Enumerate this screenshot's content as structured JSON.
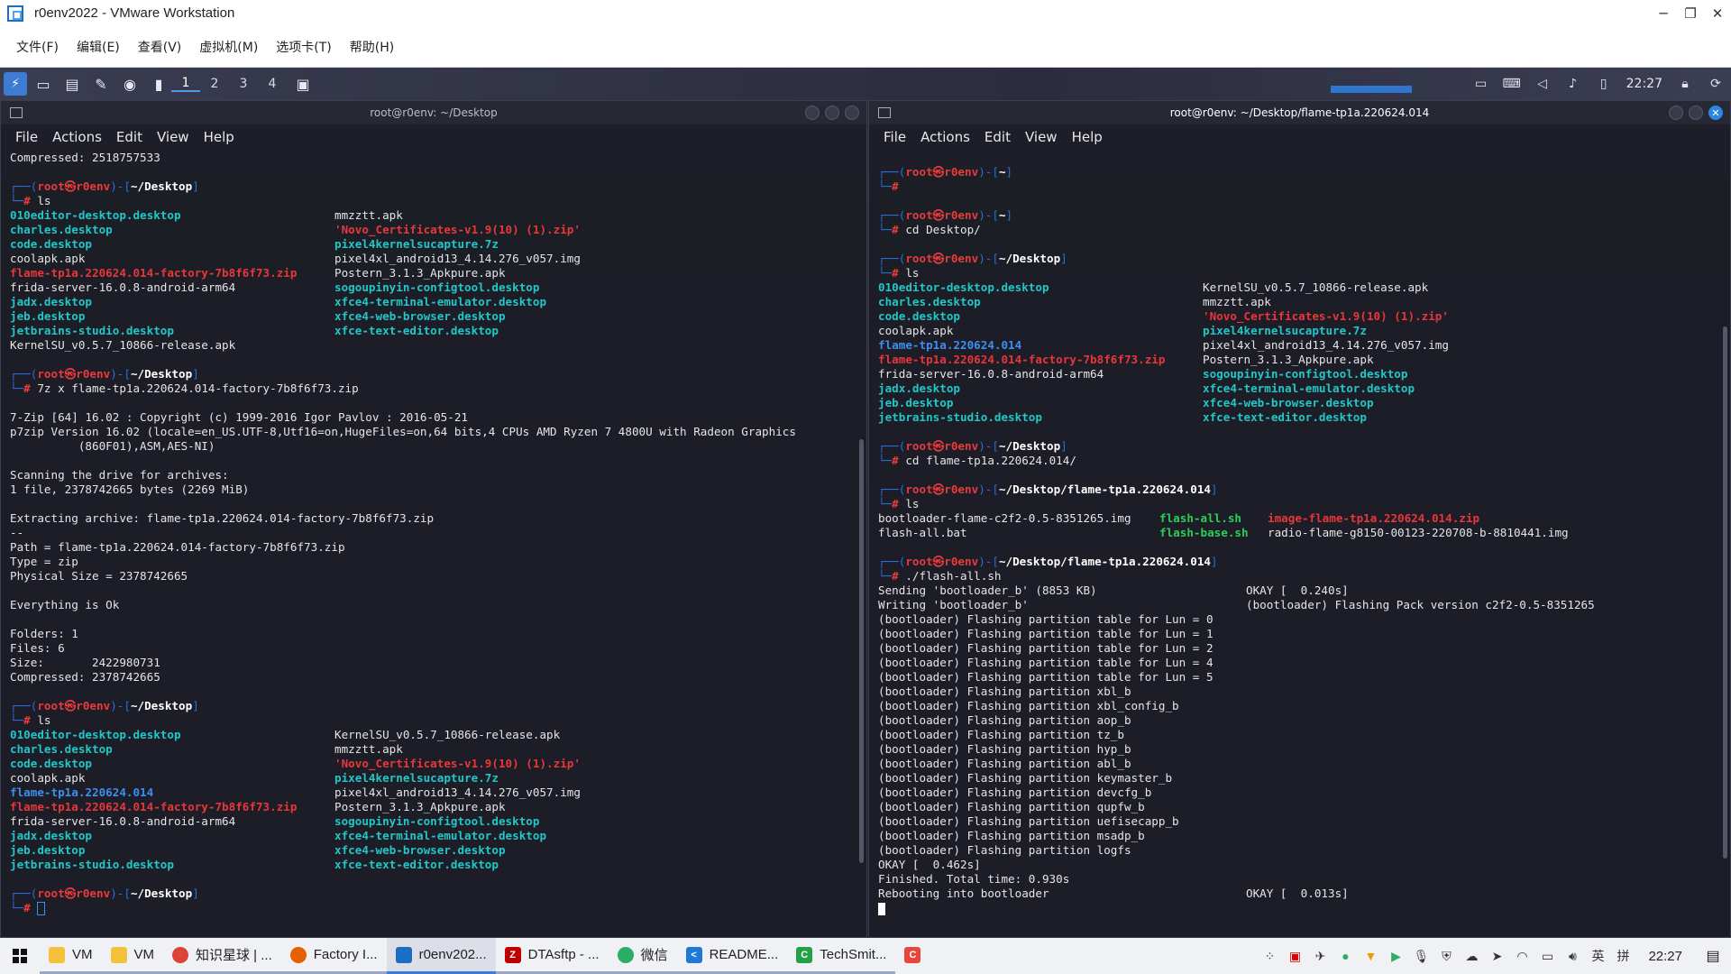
{
  "vmware": {
    "title": "r0env2022 - VMware Workstation",
    "menu": [
      "文件(F)",
      "编辑(E)",
      "查看(V)",
      "虚拟机(M)",
      "选项卡(T)",
      "帮助(H)"
    ],
    "controls": {
      "minimize": "─",
      "restore": "❐",
      "close": "✕"
    }
  },
  "panel": {
    "workspaces": [
      "1",
      "2",
      "3",
      "4"
    ],
    "clock": "22:27"
  },
  "left_terminal": {
    "title": "root@r0env: ~/Desktop",
    "menu": [
      "File",
      "Actions",
      "Edit",
      "View",
      "Help"
    ]
  },
  "right_terminal": {
    "title": "root@r0env: ~/Desktop/flame-tp1a.220624.014",
    "menu": [
      "File",
      "Actions",
      "Edit",
      "View",
      "Help"
    ]
  },
  "colors": {
    "prompt_user": "#e83b3b",
    "prompt_deco": "#2f6bd8",
    "file_desktop": "#22c7c7",
    "file_archive": "#e8373a",
    "file_dir": "#3d8ef0",
    "file_exec": "#2ccf56"
  },
  "taskbar": {
    "items": [
      {
        "label": "VM",
        "icon": "folder-icon",
        "color": "#f3c13a"
      },
      {
        "label": "VM",
        "icon": "folder-icon",
        "color": "#f3c13a"
      },
      {
        "label": "知识星球 | ...",
        "icon": "chrome-icon",
        "color": "#db4437"
      },
      {
        "label": "Factory I...",
        "icon": "firefox-icon",
        "color": "#e66000"
      },
      {
        "label": "r0env202...",
        "icon": "vmware-icon",
        "color": "#1a6fc4"
      },
      {
        "label": "DTAsftp - ...",
        "icon": "filezilla-icon",
        "color": "#bf0000"
      },
      {
        "label": "微信",
        "icon": "wechat-icon",
        "color": "#2aae67"
      },
      {
        "label": "README...",
        "icon": "vscode-icon",
        "color": "#1f7ad6"
      },
      {
        "label": "TechSmit...",
        "icon": "camtasia-icon",
        "color": "#24a148"
      }
    ],
    "ime": "英",
    "ime2": "拼",
    "clock": "22:27"
  }
}
